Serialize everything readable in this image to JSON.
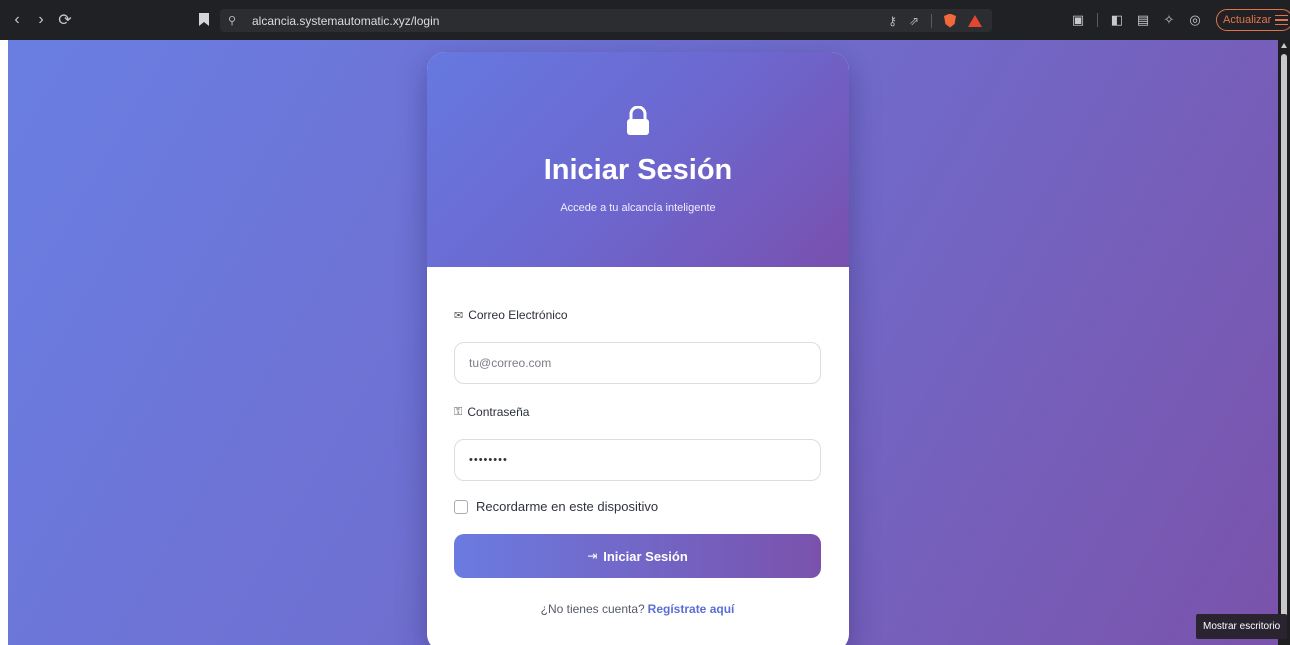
{
  "browser": {
    "url": "alcancia.systemautomatic.xyz/login",
    "update_label": "Actualizar",
    "nav": {
      "back": "‹",
      "forward": "›",
      "reload": "⟳"
    },
    "icons": [
      "key-icon",
      "share-icon",
      "brave-shield-icon",
      "rewards-triangle-icon",
      "screenshot-icon",
      "sidebar-icon",
      "wallet-icon",
      "leo-ai-icon",
      "vpn-icon",
      "menu-icon"
    ]
  },
  "card": {
    "title": "Iniciar Sesión",
    "subtitle": "Accede a tu alcancía inteligente"
  },
  "form": {
    "email_label": "Correo Electrónico",
    "email_placeholder": "tu@correo.com",
    "password_label": "Contraseña",
    "password_value": "••••••••",
    "remember_label": "Recordarme en este dispositivo",
    "remember_checked": false,
    "submit_label": "Iniciar Sesión",
    "no_account_text": "¿No tienes cuenta?",
    "register_link": "Regístrate aquí"
  },
  "tooltip": "Mostrar escritorio",
  "colors": {
    "gradient_start": "#6a7ee2",
    "gradient_end": "#7a53ab",
    "link": "#5a6fd6",
    "update_accent": "#e1734d"
  }
}
